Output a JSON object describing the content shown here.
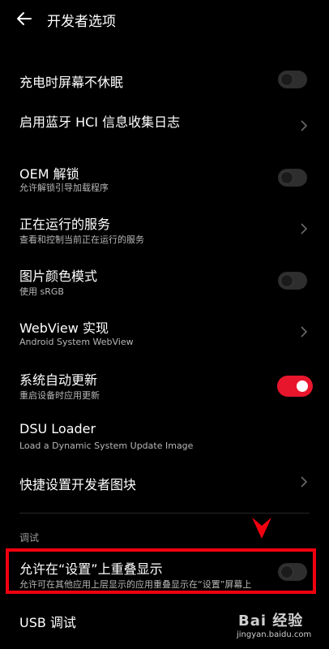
{
  "header": {
    "title": "开发者选项"
  },
  "items": [
    {
      "label": "充电时屏幕不休眠",
      "toggle": "off"
    },
    {
      "label": "启用蓝牙 HCI 信息收集日志",
      "chevron": true
    },
    {
      "label": "OEM 解锁",
      "sub": "允许解锁引导加载程序",
      "toggle": "off"
    },
    {
      "label": "正在运行的服务",
      "sub": "查看和控制当前正在运行的服务",
      "chevron": true
    },
    {
      "label": "图片颜色模式",
      "sub": "使用 sRGB",
      "toggle": "off"
    },
    {
      "label": "WebView 实现",
      "sub": "Android System WebView",
      "chevron": true
    },
    {
      "label": "系统自动更新",
      "sub": "重启设备时应用更新",
      "toggle": "on"
    },
    {
      "label": "DSU Loader",
      "sub": "Load a Dynamic System Update Image"
    },
    {
      "label": "快捷设置开发者图块",
      "chevron": true
    }
  ],
  "section_debug": "调试",
  "overlay_item": {
    "label": "允许在“设置”上重叠显示",
    "sub": "允许可在其他应用上层显示的应用重叠显示在“设置”屏幕上",
    "toggle": "off"
  },
  "usb_item": {
    "label": "USB 调试"
  },
  "watermark": {
    "brand": "Bai 经验",
    "domain": "jingyan.baidu.com"
  },
  "colors": {
    "accent": "#e8162d",
    "highlight_box": "#f20010"
  }
}
